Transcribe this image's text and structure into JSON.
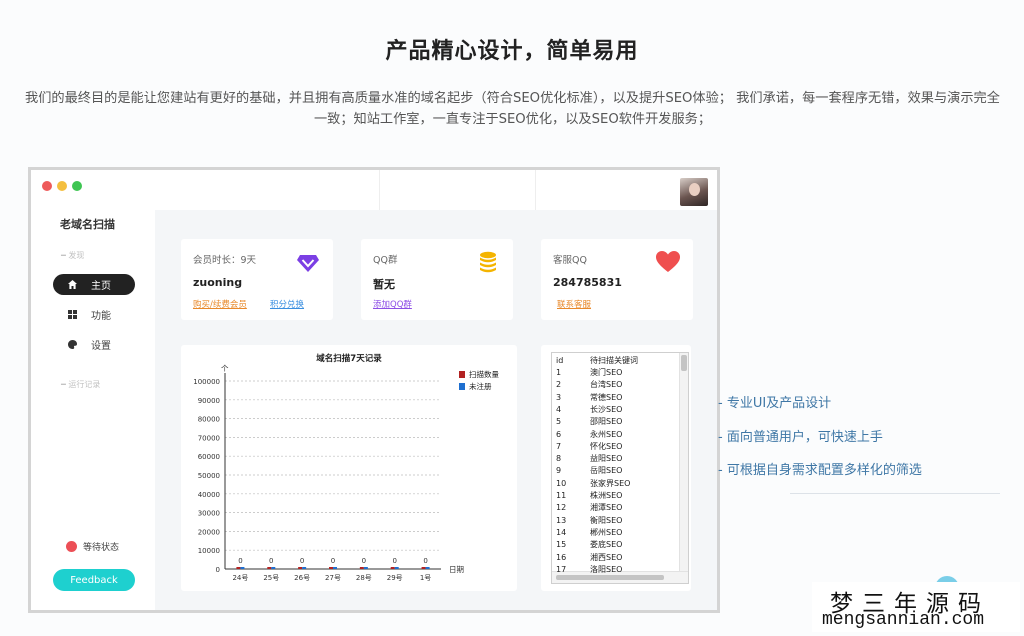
{
  "headline": "产品精心设计，简单易用",
  "description": "我们的最终目的是能让您建站有更好的基础，并且拥有高质量水准的域名起步（符合SEO优化标准），以及提升SEO体验； 我们承诺，每一套程序无错，效果与演示完全一致；知站工作室，一直专注于SEO优化，以及SEO软件开发服务；",
  "app": {
    "window_dots": [
      "#ee5a5a",
      "#f4bf3f",
      "#3ec552"
    ],
    "brand": "老域名扫描",
    "group1": "━ 发现",
    "nav": [
      {
        "label": "主页",
        "icon": "home-icon",
        "active": true
      },
      {
        "label": "功能",
        "icon": "grid-icon",
        "active": false
      },
      {
        "label": "设置",
        "icon": "palette-icon",
        "active": false
      }
    ],
    "group2": "━ 运行记录",
    "status_label": "等待状态",
    "feedback_label": "Feedback",
    "cards": [
      {
        "title": "会员时长：9天",
        "value": "zuoning",
        "links": [
          "购买/续费会员",
          "积分兑换"
        ],
        "icon": "diamond-icon",
        "icon_color": "#7b3fe4"
      },
      {
        "title": "QQ群",
        "value": "暂无",
        "links": [
          "添加QQ群"
        ],
        "icon": "coins-icon",
        "icon_color": "#f4b400"
      },
      {
        "title": "客服QQ",
        "value": "284785831",
        "links": [
          "联系客服"
        ],
        "icon": "heart-icon",
        "icon_color": "#ef4f4f"
      }
    ],
    "link_colors": [
      "#e8892b",
      "#3b8fe0",
      "#8e4fe6",
      "#e8892b"
    ],
    "keyword_table": {
      "headers": [
        "id",
        "待扫描关键词"
      ],
      "rows": [
        [
          "1",
          "澳门SEO"
        ],
        [
          "2",
          "台湾SEO"
        ],
        [
          "3",
          "常德SEO"
        ],
        [
          "4",
          "长沙SEO"
        ],
        [
          "5",
          "邵阳SEO"
        ],
        [
          "6",
          "永州SEO"
        ],
        [
          "7",
          "怀化SEO"
        ],
        [
          "8",
          "益阳SEO"
        ],
        [
          "9",
          "岳阳SEO"
        ],
        [
          "10",
          "张家界SEO"
        ],
        [
          "11",
          "株洲SEO"
        ],
        [
          "12",
          "湘潭SEO"
        ],
        [
          "13",
          "衡阳SEO"
        ],
        [
          "14",
          "郴州SEO"
        ],
        [
          "15",
          "娄底SEO"
        ],
        [
          "16",
          "湘西SEO"
        ],
        [
          "17",
          "洛阳SEO"
        ]
      ]
    }
  },
  "chart_data": {
    "type": "bar",
    "title": "域名扫描7天记录",
    "categories": [
      "24号",
      "25号",
      "26号",
      "27号",
      "28号",
      "29号",
      "1号"
    ],
    "xlabel": "日期",
    "ylabel": "个",
    "ylim": [
      0,
      100000
    ],
    "yticks": [
      0,
      10000,
      20000,
      30000,
      40000,
      50000,
      60000,
      70000,
      80000,
      90000,
      100000
    ],
    "grid": true,
    "legend_position": "top-right",
    "series": [
      {
        "name": "扫描数量",
        "color": "#b22222",
        "values": [
          0,
          0,
          0,
          0,
          0,
          0,
          0
        ]
      },
      {
        "name": "未注册",
        "color": "#1e6fd0",
        "values": [
          0,
          0,
          0,
          0,
          0,
          0,
          0
        ]
      }
    ],
    "data_labels": [
      "0",
      "0",
      "0",
      "0",
      "0",
      "0",
      "0"
    ]
  },
  "features": [
    "- 专业UI及产品设计",
    "- 面向普通用户，可快速上手",
    "- 可根据自身需求配置多样化的筛选"
  ],
  "watermark": {
    "line1": "梦三年源码",
    "line2": "mengsannian.com"
  }
}
